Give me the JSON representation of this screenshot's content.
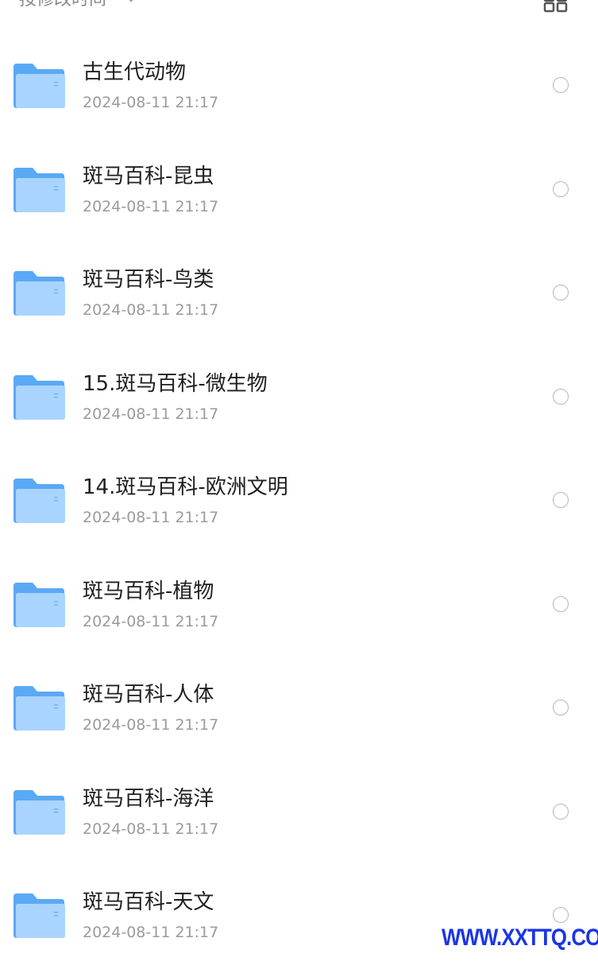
{
  "header": {
    "sort_label": "按修改时间",
    "sort_icon": "caret-down-icon",
    "view_icon": "grid-view-icon"
  },
  "colors": {
    "folder_back": "#5aa9f5",
    "folder_front": "#a9d4ff",
    "name_text": "#1f1f1f",
    "date_text": "#9b9b9b",
    "watermark": "#1b35e6"
  },
  "folders": [
    {
      "name": "古生代动物",
      "date": "2024-08-11 21:17"
    },
    {
      "name": "斑马百科-昆虫",
      "date": "2024-08-11 21:17"
    },
    {
      "name": "斑马百科-鸟类",
      "date": "2024-08-11 21:17"
    },
    {
      "name": "15.斑马百科-微生物",
      "date": "2024-08-11 21:17"
    },
    {
      "name": "14.斑马百科-欧洲文明",
      "date": "2024-08-11 21:17"
    },
    {
      "name": "斑马百科-植物",
      "date": "2024-08-11 21:17"
    },
    {
      "name": "斑马百科-人体",
      "date": "2024-08-11 21:17"
    },
    {
      "name": "斑马百科-海洋",
      "date": "2024-08-11 21:17"
    },
    {
      "name": "斑马百科-天文",
      "date": "2024-08-11 21:17"
    }
  ],
  "watermark": "WWW.XXTTQ.COM"
}
